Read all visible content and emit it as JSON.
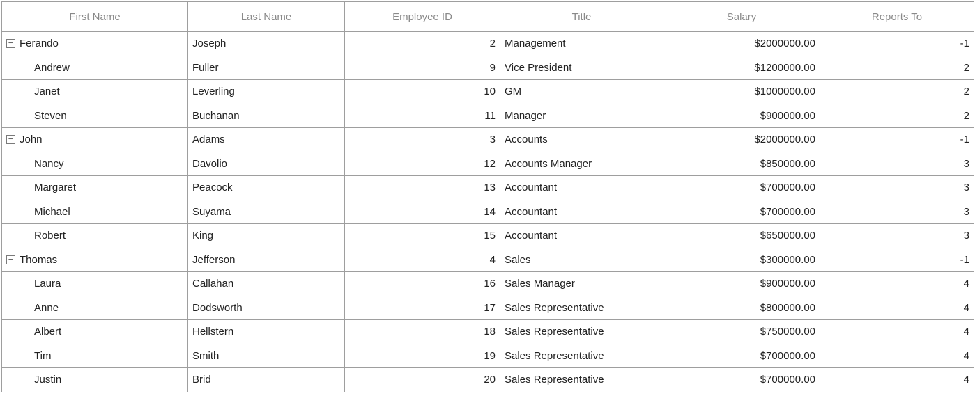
{
  "columns": {
    "firstName": "First Name",
    "lastName": "Last Name",
    "employeeId": "Employee ID",
    "title": "Title",
    "salary": "Salary",
    "reportsTo": "Reports To"
  },
  "rows": [
    {
      "level": 0,
      "expandable": true,
      "firstName": "Ferando",
      "lastName": "Joseph",
      "employeeId": "2",
      "title": "Management",
      "salary": "$2000000.00",
      "reportsTo": "-1"
    },
    {
      "level": 1,
      "expandable": false,
      "firstName": "Andrew",
      "lastName": "Fuller",
      "employeeId": "9",
      "title": "Vice President",
      "salary": "$1200000.00",
      "reportsTo": "2"
    },
    {
      "level": 1,
      "expandable": false,
      "firstName": "Janet",
      "lastName": "Leverling",
      "employeeId": "10",
      "title": "GM",
      "salary": "$1000000.00",
      "reportsTo": "2"
    },
    {
      "level": 1,
      "expandable": false,
      "firstName": "Steven",
      "lastName": "Buchanan",
      "employeeId": "11",
      "title": "Manager",
      "salary": "$900000.00",
      "reportsTo": "2"
    },
    {
      "level": 0,
      "expandable": true,
      "firstName": "John",
      "lastName": "Adams",
      "employeeId": "3",
      "title": "Accounts",
      "salary": "$2000000.00",
      "reportsTo": "-1"
    },
    {
      "level": 1,
      "expandable": false,
      "firstName": "Nancy",
      "lastName": "Davolio",
      "employeeId": "12",
      "title": "Accounts Manager",
      "salary": "$850000.00",
      "reportsTo": "3"
    },
    {
      "level": 1,
      "expandable": false,
      "firstName": "Margaret",
      "lastName": "Peacock",
      "employeeId": "13",
      "title": "Accountant",
      "salary": "$700000.00",
      "reportsTo": "3"
    },
    {
      "level": 1,
      "expandable": false,
      "firstName": "Michael",
      "lastName": "Suyama",
      "employeeId": "14",
      "title": "Accountant",
      "salary": "$700000.00",
      "reportsTo": "3"
    },
    {
      "level": 1,
      "expandable": false,
      "firstName": "Robert",
      "lastName": "King",
      "employeeId": "15",
      "title": "Accountant",
      "salary": "$650000.00",
      "reportsTo": "3"
    },
    {
      "level": 0,
      "expandable": true,
      "firstName": "Thomas",
      "lastName": "Jefferson",
      "employeeId": "4",
      "title": "Sales",
      "salary": "$300000.00",
      "reportsTo": "-1"
    },
    {
      "level": 1,
      "expandable": false,
      "firstName": "Laura",
      "lastName": "Callahan",
      "employeeId": "16",
      "title": "Sales Manager",
      "salary": "$900000.00",
      "reportsTo": "4"
    },
    {
      "level": 1,
      "expandable": false,
      "firstName": "Anne",
      "lastName": "Dodsworth",
      "employeeId": "17",
      "title": "Sales Representative",
      "salary": "$800000.00",
      "reportsTo": "4"
    },
    {
      "level": 1,
      "expandable": false,
      "firstName": "Albert",
      "lastName": "Hellstern",
      "employeeId": "18",
      "title": "Sales Representative",
      "salary": "$750000.00",
      "reportsTo": "4"
    },
    {
      "level": 1,
      "expandable": false,
      "firstName": "Tim",
      "lastName": "Smith",
      "employeeId": "19",
      "title": "Sales Representative",
      "salary": "$700000.00",
      "reportsTo": "4"
    },
    {
      "level": 1,
      "expandable": false,
      "firstName": "Justin",
      "lastName": "Brid",
      "employeeId": "20",
      "title": "Sales Representative",
      "salary": "$700000.00",
      "reportsTo": "4"
    }
  ]
}
